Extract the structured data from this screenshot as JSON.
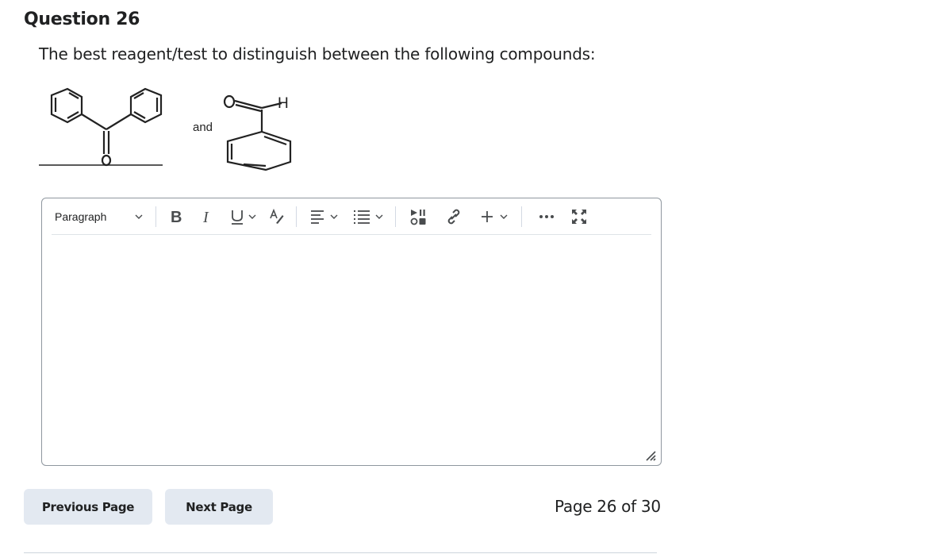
{
  "question": {
    "title": "Question 26",
    "prompt": "The best reagent/test to distinguish between the following compounds:",
    "compounds": {
      "first": "benzophenone",
      "connector": "and",
      "second": "benzaldehyde",
      "labels": {
        "oxygen": "O",
        "hydrogen": "H"
      }
    }
  },
  "editor": {
    "toolbar": {
      "block_format": "Paragraph",
      "items": [
        {
          "name": "bold",
          "label": "B"
        },
        {
          "name": "italic",
          "label": "I"
        },
        {
          "name": "underline",
          "label": "U"
        },
        {
          "name": "format-painter"
        },
        {
          "name": "align"
        },
        {
          "name": "list"
        },
        {
          "name": "media"
        },
        {
          "name": "link"
        },
        {
          "name": "insert",
          "label": "+"
        },
        {
          "name": "more"
        },
        {
          "name": "fullscreen"
        }
      ]
    },
    "value": ""
  },
  "navigation": {
    "previous_label": "Previous Page",
    "next_label": "Next Page",
    "page_info": "Page 26 of 30"
  }
}
